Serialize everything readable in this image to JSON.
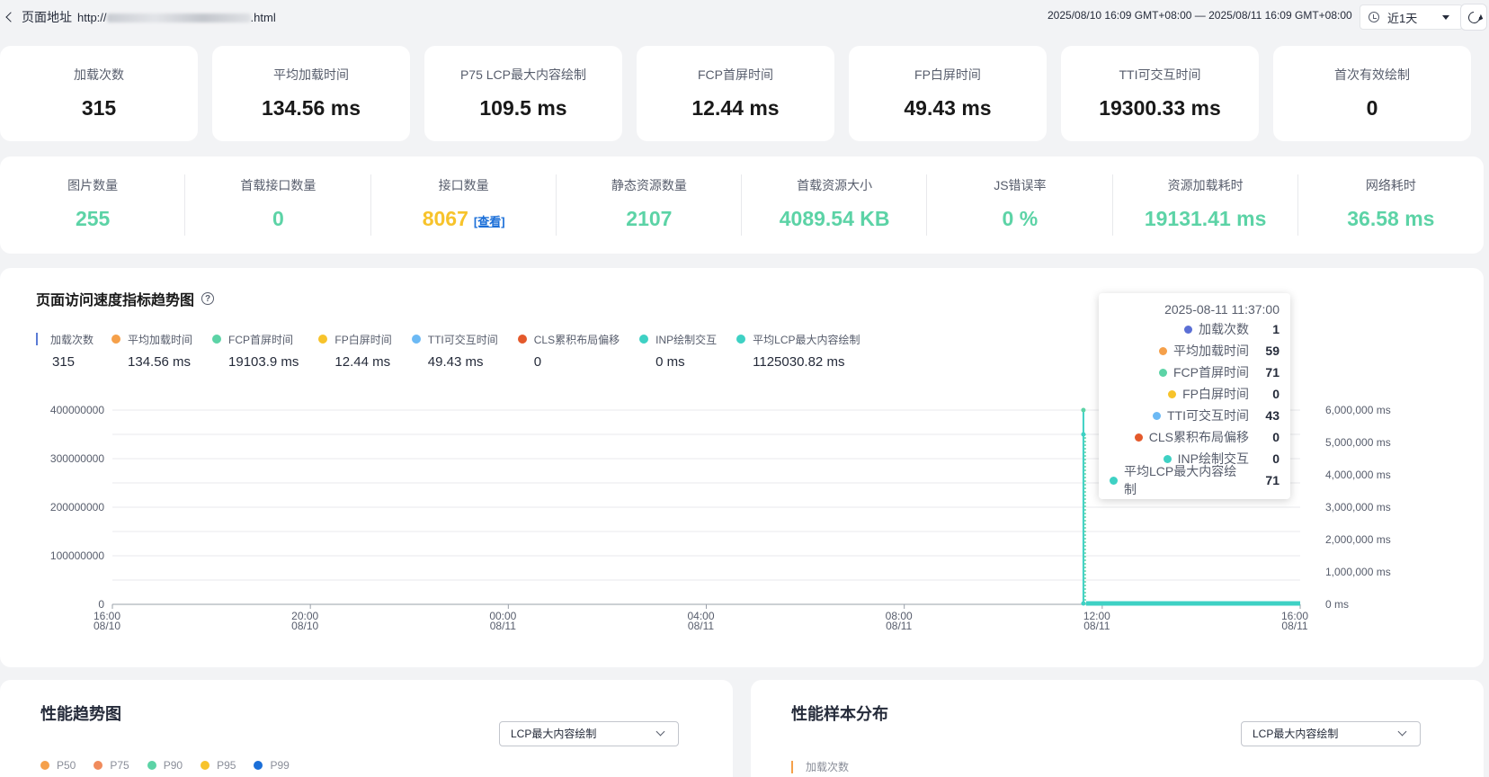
{
  "header": {
    "back_label": "页面地址",
    "url_prefix": "http://",
    "url_suffix": ".html",
    "time_range": "2025/08/10 16:09 GMT+08:00 — 2025/08/11 16:09 GMT+08:00",
    "range_select": "近1天"
  },
  "kpis": [
    {
      "label": "加载次数",
      "value": "315"
    },
    {
      "label": "平均加载时间",
      "value": "134.56 ms"
    },
    {
      "label": "P75 LCP最大内容绘制",
      "value": "109.5 ms"
    },
    {
      "label": "FCP首屏时间",
      "value": "12.44 ms"
    },
    {
      "label": "FP白屏时间",
      "value": "49.43 ms"
    },
    {
      "label": "TTI可交互时间",
      "value": "19300.33 ms"
    },
    {
      "label": "首次有效绘制",
      "value": "0"
    }
  ],
  "stats": [
    {
      "label": "图片数量",
      "value": "255"
    },
    {
      "label": "首载接口数量",
      "value": "0"
    },
    {
      "label": "接口数量",
      "value": "8067",
      "link": "[查看]"
    },
    {
      "label": "静态资源数量",
      "value": "2107"
    },
    {
      "label": "首载资源大小",
      "value": "4089.54 KB"
    },
    {
      "label": "JS错误率",
      "value": "0 %"
    },
    {
      "label": "资源加载耗时",
      "value": "19131.41 ms"
    },
    {
      "label": "网络耗时",
      "value": "36.58 ms"
    }
  ],
  "trend": {
    "title": "页面访问速度指标趋势图",
    "legend": [
      {
        "name": "加载次数",
        "value": "315",
        "color": "#5b7bd5",
        "kind": "bar"
      },
      {
        "name": "平均加载时间",
        "value": "134.56 ms",
        "color": "#f5a04a",
        "kind": "dot"
      },
      {
        "name": "FCP首屏时间",
        "value": "19103.9 ms",
        "color": "#5cd3a6",
        "kind": "dot"
      },
      {
        "name": "FP白屏时间",
        "value": "12.44 ms",
        "color": "#f7c32b",
        "kind": "dot"
      },
      {
        "name": "TTI可交互时间",
        "value": "49.43 ms",
        "color": "#6cb9f4",
        "kind": "dot"
      },
      {
        "name": "CLS累积布局偏移",
        "value": "0",
        "color": "#e4592b",
        "kind": "dot"
      },
      {
        "name": "INP绘制交互",
        "value": "0 ms",
        "color": "#3ed1c4",
        "kind": "dot"
      },
      {
        "name": "平均LCP最大内容绘制",
        "value": "1125030.82 ms",
        "color": "#3ed1c4",
        "kind": "dot"
      }
    ],
    "tooltip": {
      "time": "2025-08-11 11:37:00",
      "rows": [
        {
          "name": "加载次数",
          "value": "1",
          "color": "#5b6fd5"
        },
        {
          "name": "平均加载时间",
          "value": "59",
          "color": "#f5a04a"
        },
        {
          "name": "FCP首屏时间",
          "value": "71",
          "color": "#5cd3a6"
        },
        {
          "name": "FP白屏时间",
          "value": "0",
          "color": "#f7c32b"
        },
        {
          "name": "TTI可交互时间",
          "value": "43",
          "color": "#6cb9f4"
        },
        {
          "name": "CLS累积布局偏移",
          "value": "0",
          "color": "#e4592b"
        },
        {
          "name": "INP绘制交互",
          "value": "0",
          "color": "#3ed1c4"
        },
        {
          "name": "平均LCP最大内容绘制",
          "value": "71",
          "color": "#3ed1c4"
        }
      ]
    }
  },
  "chart_data": {
    "type": "line",
    "x_ticks": [
      {
        "t": "16:00",
        "d": "08/10"
      },
      {
        "t": "20:00",
        "d": "08/10"
      },
      {
        "t": "00:00",
        "d": "08/11"
      },
      {
        "t": "04:00",
        "d": "08/11"
      },
      {
        "t": "08:00",
        "d": "08/11"
      },
      {
        "t": "12:00",
        "d": "08/11"
      },
      {
        "t": "16:00",
        "d": "08/11"
      }
    ],
    "x_range_hours": [
      0,
      24
    ],
    "y_left_ticks": [
      "0",
      "100000000",
      "200000000",
      "300000000",
      "400000000"
    ],
    "y_left_max": 400000000,
    "y_right_ticks": [
      "0 ms",
      "1,000,000 ms",
      "2,000,000 ms",
      "3,000,000 ms",
      "4,000,000 ms",
      "5,000,000 ms",
      "6,000,000 ms"
    ],
    "y_right_max": 6000000,
    "spike": {
      "hour": 19.62,
      "peak_left": 400000000,
      "mid_left": 350000000,
      "tail_end_hour": 24
    },
    "grid": true
  },
  "perf_trend": {
    "title": "性能趋势图",
    "select": "LCP最大内容绘制",
    "legend": [
      {
        "name": "P50",
        "color": "#f5a04a"
      },
      {
        "name": "P75",
        "color": "#f08b5c"
      },
      {
        "name": "P90",
        "color": "#5cd3a6"
      },
      {
        "name": "P95",
        "color": "#f7c32b"
      },
      {
        "name": "P99",
        "color": "#1b6fd8"
      }
    ]
  },
  "perf_dist": {
    "title": "性能样本分布",
    "select": "LCP最大内容绘制",
    "legend_label": "加载次数",
    "legend_color": "#f5a04a"
  }
}
